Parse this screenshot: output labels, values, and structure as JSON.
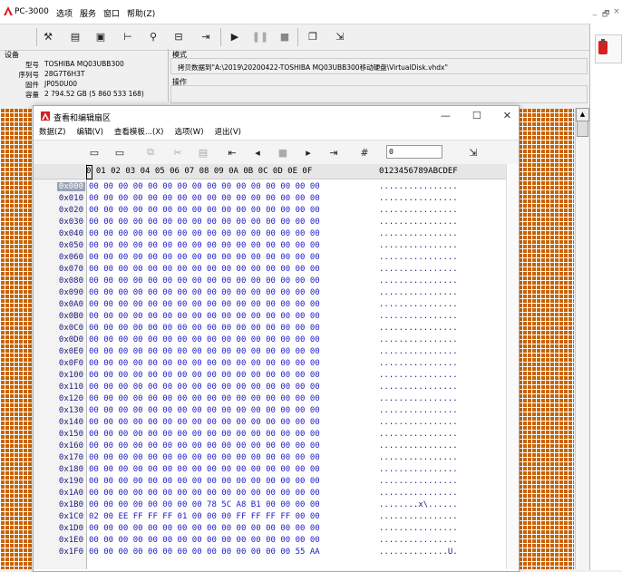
{
  "app": {
    "title": "PC-3000"
  },
  "menu": [
    "选项",
    "服务",
    "窗口",
    "帮助(Z)"
  ],
  "window_controls": [
    "_",
    "🗗",
    "×"
  ],
  "device": {
    "title": "设备",
    "rows": [
      {
        "k": "型号",
        "v": "TOSHIBA MQ03UBB300"
      },
      {
        "k": "序列号",
        "v": "28G7T6H3T"
      },
      {
        "k": "固件",
        "v": "JP050U00"
      },
      {
        "k": "容量",
        "v": "2 794.52 GB (5 860 533 168)"
      }
    ]
  },
  "mode": {
    "title": "模式",
    "text": "拷贝数据到\"A:\\2019\\20200422-TOSHIBA MQ03UBB300移动硬盘\\VirtualDisk.vhdx\""
  },
  "operation": {
    "title": "操作"
  },
  "editor": {
    "title": "查看和编辑扇区",
    "controls": [
      "—",
      "☐",
      "✕"
    ],
    "menu": [
      "数据(Z)",
      "编辑(V)",
      "查看模板...(X)",
      "选项(W)",
      "退出(V)"
    ],
    "input_value": "0",
    "hex_header": "0 01 02 03 04 05 06 07 08 09 0A 0B 0C 0D 0E 0F",
    "ascii_header": "0123456789ABCDEF",
    "rows": [
      {
        "off": "0x000",
        "hex": "00 00 00 00 00 00 00 00 00 00 00 00 00 00 00 00",
        "ascii": "................"
      },
      {
        "off": "0x010",
        "hex": "00 00 00 00 00 00 00 00 00 00 00 00 00 00 00 00",
        "ascii": "................"
      },
      {
        "off": "0x020",
        "hex": "00 00 00 00 00 00 00 00 00 00 00 00 00 00 00 00",
        "ascii": "................"
      },
      {
        "off": "0x030",
        "hex": "00 00 00 00 00 00 00 00 00 00 00 00 00 00 00 00",
        "ascii": "................"
      },
      {
        "off": "0x040",
        "hex": "00 00 00 00 00 00 00 00 00 00 00 00 00 00 00 00",
        "ascii": "................"
      },
      {
        "off": "0x050",
        "hex": "00 00 00 00 00 00 00 00 00 00 00 00 00 00 00 00",
        "ascii": "................"
      },
      {
        "off": "0x060",
        "hex": "00 00 00 00 00 00 00 00 00 00 00 00 00 00 00 00",
        "ascii": "................"
      },
      {
        "off": "0x070",
        "hex": "00 00 00 00 00 00 00 00 00 00 00 00 00 00 00 00",
        "ascii": "................"
      },
      {
        "off": "0x080",
        "hex": "00 00 00 00 00 00 00 00 00 00 00 00 00 00 00 00",
        "ascii": "................"
      },
      {
        "off": "0x090",
        "hex": "00 00 00 00 00 00 00 00 00 00 00 00 00 00 00 00",
        "ascii": "................"
      },
      {
        "off": "0x0A0",
        "hex": "00 00 00 00 00 00 00 00 00 00 00 00 00 00 00 00",
        "ascii": "................"
      },
      {
        "off": "0x0B0",
        "hex": "00 00 00 00 00 00 00 00 00 00 00 00 00 00 00 00",
        "ascii": "................"
      },
      {
        "off": "0x0C0",
        "hex": "00 00 00 00 00 00 00 00 00 00 00 00 00 00 00 00",
        "ascii": "................"
      },
      {
        "off": "0x0D0",
        "hex": "00 00 00 00 00 00 00 00 00 00 00 00 00 00 00 00",
        "ascii": "................"
      },
      {
        "off": "0x0E0",
        "hex": "00 00 00 00 00 00 00 00 00 00 00 00 00 00 00 00",
        "ascii": "................"
      },
      {
        "off": "0x0F0",
        "hex": "00 00 00 00 00 00 00 00 00 00 00 00 00 00 00 00",
        "ascii": "................"
      },
      {
        "off": "0x100",
        "hex": "00 00 00 00 00 00 00 00 00 00 00 00 00 00 00 00",
        "ascii": "................"
      },
      {
        "off": "0x110",
        "hex": "00 00 00 00 00 00 00 00 00 00 00 00 00 00 00 00",
        "ascii": "................"
      },
      {
        "off": "0x120",
        "hex": "00 00 00 00 00 00 00 00 00 00 00 00 00 00 00 00",
        "ascii": "................"
      },
      {
        "off": "0x130",
        "hex": "00 00 00 00 00 00 00 00 00 00 00 00 00 00 00 00",
        "ascii": "................"
      },
      {
        "off": "0x140",
        "hex": "00 00 00 00 00 00 00 00 00 00 00 00 00 00 00 00",
        "ascii": "................"
      },
      {
        "off": "0x150",
        "hex": "00 00 00 00 00 00 00 00 00 00 00 00 00 00 00 00",
        "ascii": "................"
      },
      {
        "off": "0x160",
        "hex": "00 00 00 00 00 00 00 00 00 00 00 00 00 00 00 00",
        "ascii": "................"
      },
      {
        "off": "0x170",
        "hex": "00 00 00 00 00 00 00 00 00 00 00 00 00 00 00 00",
        "ascii": "................"
      },
      {
        "off": "0x180",
        "hex": "00 00 00 00 00 00 00 00 00 00 00 00 00 00 00 00",
        "ascii": "................"
      },
      {
        "off": "0x190",
        "hex": "00 00 00 00 00 00 00 00 00 00 00 00 00 00 00 00",
        "ascii": "................"
      },
      {
        "off": "0x1A0",
        "hex": "00 00 00 00 00 00 00 00 00 00 00 00 00 00 00 00",
        "ascii": "................"
      },
      {
        "off": "0x1B0",
        "hex": "00 00 00 00 00 00 00 00 78 5C A8 B1 00 00 00 00",
        "ascii": "........x\\......"
      },
      {
        "off": "0x1C0",
        "hex": "02 00 EE FF FF FF 01 00 00 00 FF FF FF FF 00 00",
        "ascii": "................"
      },
      {
        "off": "0x1D0",
        "hex": "00 00 00 00 00 00 00 00 00 00 00 00 00 00 00 00",
        "ascii": "................"
      },
      {
        "off": "0x1E0",
        "hex": "00 00 00 00 00 00 00 00 00 00 00 00 00 00 00 00",
        "ascii": "................"
      },
      {
        "off": "0x1F0",
        "hex": "00 00 00 00 00 00 00 00 00 00 00 00 00 00 55 AA",
        "ascii": "..............U."
      }
    ]
  },
  "colors": {
    "map": "#c86400",
    "hex_text": "#1a1acc",
    "selected_offset": "#9aa3b5",
    "logo_red": "#d42020"
  }
}
